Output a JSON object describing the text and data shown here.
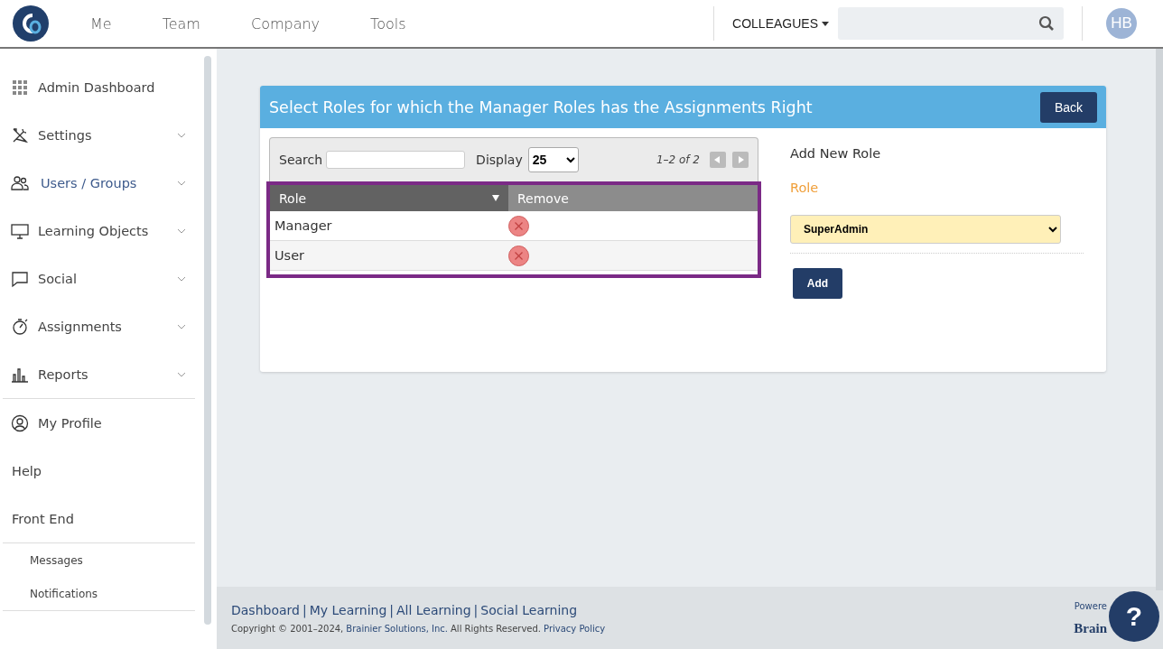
{
  "header": {
    "nav": [
      {
        "label": "Me"
      },
      {
        "label": "Team"
      },
      {
        "label": "Company"
      },
      {
        "label": "Tools"
      }
    ],
    "scope_menu": "COLLEAGUES",
    "avatar": "HB"
  },
  "sidebar": {
    "groups": [
      {
        "items": [
          {
            "label": "Admin Dashboard",
            "selected": false,
            "expandable": false
          },
          {
            "label": "Settings",
            "selected": false,
            "expandable": true
          },
          {
            "label": "Users / Groups",
            "selected": true,
            "expandable": true
          },
          {
            "label": "Learning Objects",
            "selected": false,
            "expandable": true
          },
          {
            "label": "Social",
            "selected": false,
            "expandable": true
          },
          {
            "label": "Assignments",
            "selected": false,
            "expandable": true
          },
          {
            "label": "Reports",
            "selected": false,
            "expandable": true
          }
        ]
      },
      {
        "items": [
          {
            "label": "My Profile",
            "selected": false,
            "expandable": false
          },
          {
            "label": "Help",
            "selected": false,
            "expandable": false
          },
          {
            "label": "Front End",
            "selected": false,
            "expandable": false
          }
        ]
      },
      {
        "items": [
          {
            "label": "Messages",
            "selected": false,
            "expandable": false
          },
          {
            "label": "Notifications",
            "selected": false,
            "expandable": false
          }
        ]
      }
    ]
  },
  "card": {
    "title": "Select Roles for which the Manager Roles has the Assignments Right",
    "back_button": "Back",
    "grid": {
      "search_label": "Search",
      "display_label": "Display",
      "display_value": "25",
      "paging": "1–2 of 2",
      "columns": [
        {
          "label": "Role",
          "sorted": true
        },
        {
          "label": "Remove",
          "sorted": false
        }
      ],
      "rows": [
        {
          "role": "Manager"
        },
        {
          "role": "User"
        }
      ]
    },
    "add_form": {
      "heading": "Add New Role",
      "field_label": "Role",
      "role_value": "SuperAdmin",
      "add_button": "Add"
    }
  },
  "footer": {
    "links": [
      {
        "label": "Dashboard"
      },
      {
        "label": "My Learning"
      },
      {
        "label": "All Learning"
      },
      {
        "label": "Social Learning"
      }
    ],
    "separator": "|",
    "copyright": "Copyright © 2001–2024,",
    "company": "Brainier Solutions, Inc.",
    "rights": "All Rights Reserved.",
    "privacy": "Privacy Policy",
    "powered": "Powere",
    "brand": "Brain",
    "help_button": "?"
  }
}
